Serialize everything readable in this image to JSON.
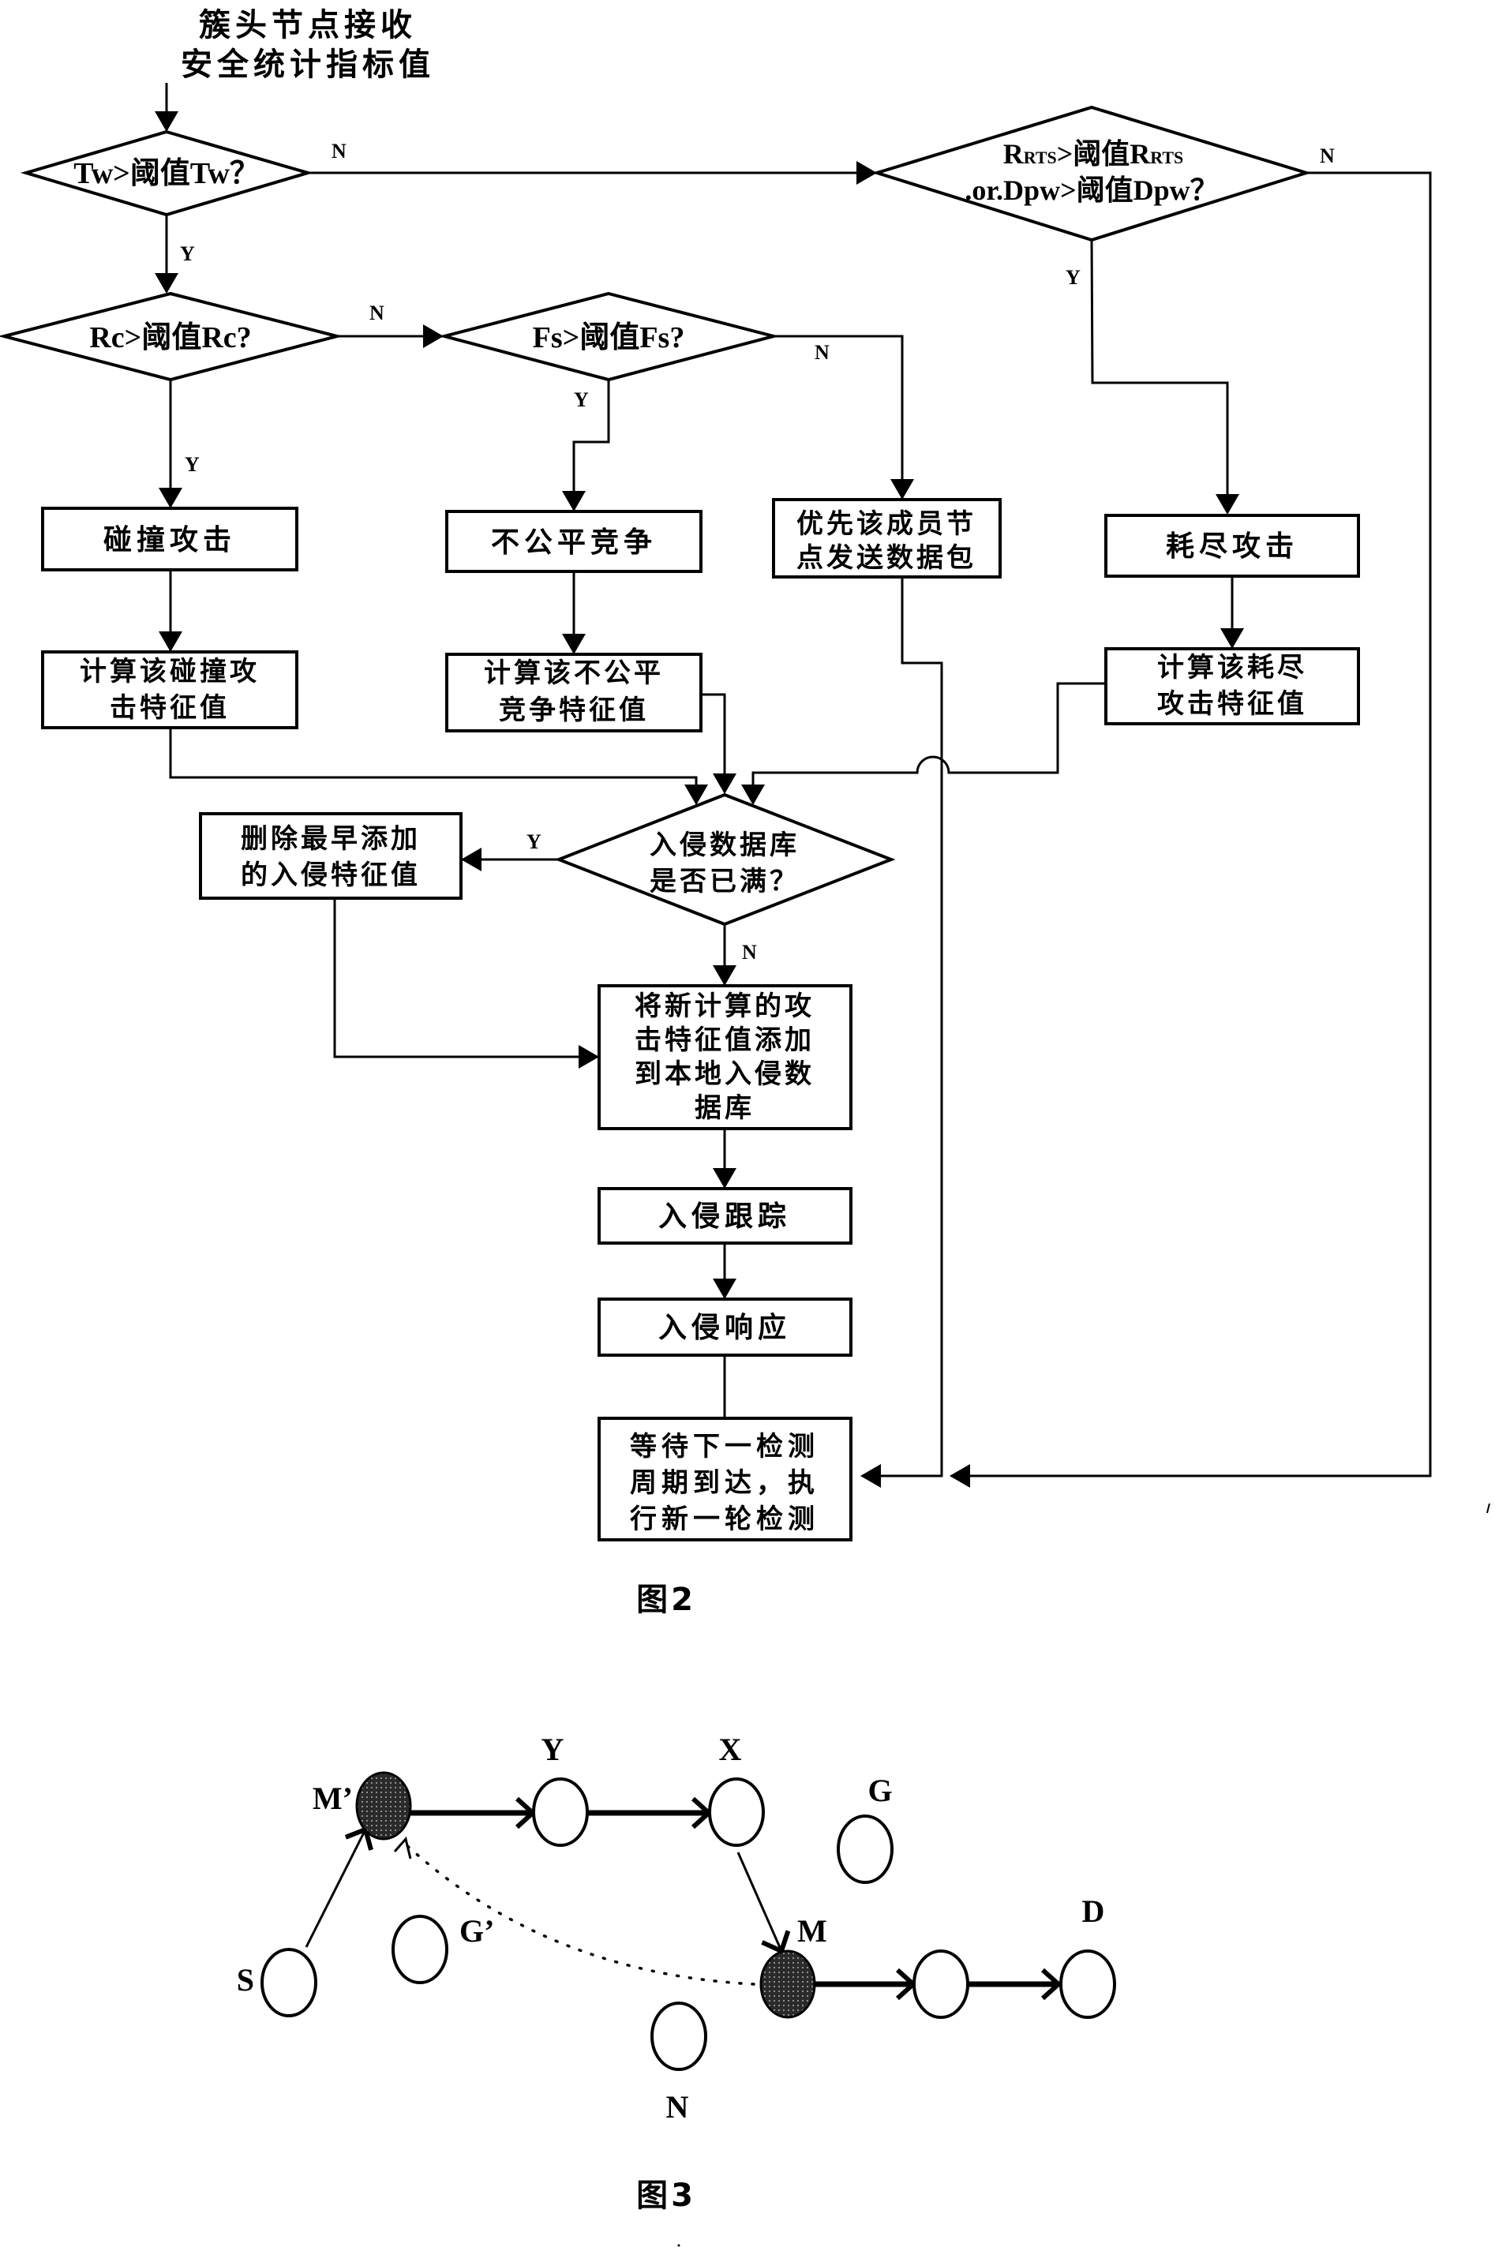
{
  "figure2": {
    "caption": "图2",
    "start": {
      "lines": [
        "簇头节点接收",
        "安全统计指标值"
      ]
    },
    "decisions": {
      "tw": {
        "text": "Tw>阈值Tw？"
      },
      "rrts": {
        "line1_main": "R",
        "line1_sub": "RTS",
        "line1_mid": ">阈值R",
        "line1_sub2": "RTS",
        "line2": ".or.Dpw>阈值Dpw？"
      },
      "rc": {
        "text": "Rc>阈值Rc?"
      },
      "fs": {
        "text": "Fs>阈值Fs?"
      },
      "db_full": {
        "lines": [
          "入侵数据库",
          "是否已满？"
        ]
      }
    },
    "processes": {
      "collision": {
        "lines": [
          "碰撞攻击"
        ]
      },
      "unfair": {
        "lines": [
          "不公平竞争"
        ]
      },
      "priority": {
        "lines": [
          "优先该成员节",
          "点发送数据包"
        ]
      },
      "exhaust": {
        "lines": [
          "耗尽攻击"
        ]
      },
      "calc_collision": {
        "lines": [
          "计算该碰撞攻",
          "击特征值"
        ]
      },
      "calc_unfair": {
        "lines": [
          "计算该不公平",
          "竞争特征值"
        ]
      },
      "calc_exhaust": {
        "lines": [
          "计算该耗尽",
          "攻击特征值"
        ]
      },
      "delete_oldest": {
        "lines": [
          "删除最早添加",
          "的入侵特征值"
        ]
      },
      "add_new": {
        "lines": [
          "将新计算的攻",
          "击特征值添加",
          "到本地入侵数",
          "据库"
        ]
      },
      "trace": {
        "lines": [
          "入侵跟踪"
        ]
      },
      "respond": {
        "lines": [
          "入侵响应"
        ]
      },
      "wait": {
        "lines": [
          "等待下一检测",
          "周期到达，执",
          "行新一轮检测"
        ]
      }
    },
    "edge_labels": {
      "tw_no": "N",
      "tw_yes": "Y",
      "rrts_no": "N",
      "rrts_yes": "Y",
      "rc_no": "N",
      "rc_yes": "Y",
      "fs_no": "N",
      "fs_yes": "Y",
      "db_yes": "Y",
      "db_no": "N"
    }
  },
  "figure3": {
    "caption": "图3",
    "nodes": [
      {
        "id": "S",
        "label": "S",
        "malicious": false
      },
      {
        "id": "M_prime",
        "label": "M’",
        "malicious": true
      },
      {
        "id": "Y",
        "label": "Y",
        "malicious": false
      },
      {
        "id": "X",
        "label": "X",
        "malicious": false
      },
      {
        "id": "G",
        "label": "G",
        "malicious": false
      },
      {
        "id": "G_prime",
        "label": "G’",
        "malicious": false
      },
      {
        "id": "M",
        "label": "M",
        "malicious": true
      },
      {
        "id": "relay",
        "label": "",
        "malicious": false
      },
      {
        "id": "D",
        "label": "D",
        "malicious": false
      },
      {
        "id": "N",
        "label": "N",
        "malicious": false
      }
    ],
    "edges": [
      {
        "from": "S",
        "to": "M_prime",
        "style": "solid"
      },
      {
        "from": "M_prime",
        "to": "Y",
        "style": "solid"
      },
      {
        "from": "Y",
        "to": "X",
        "style": "solid"
      },
      {
        "from": "X",
        "to": "M",
        "style": "solid"
      },
      {
        "from": "M",
        "to": "relay",
        "style": "solid"
      },
      {
        "from": "relay",
        "to": "D",
        "style": "solid"
      },
      {
        "from": "M",
        "to": "M_prime",
        "style": "dotted-tunnel"
      }
    ]
  }
}
